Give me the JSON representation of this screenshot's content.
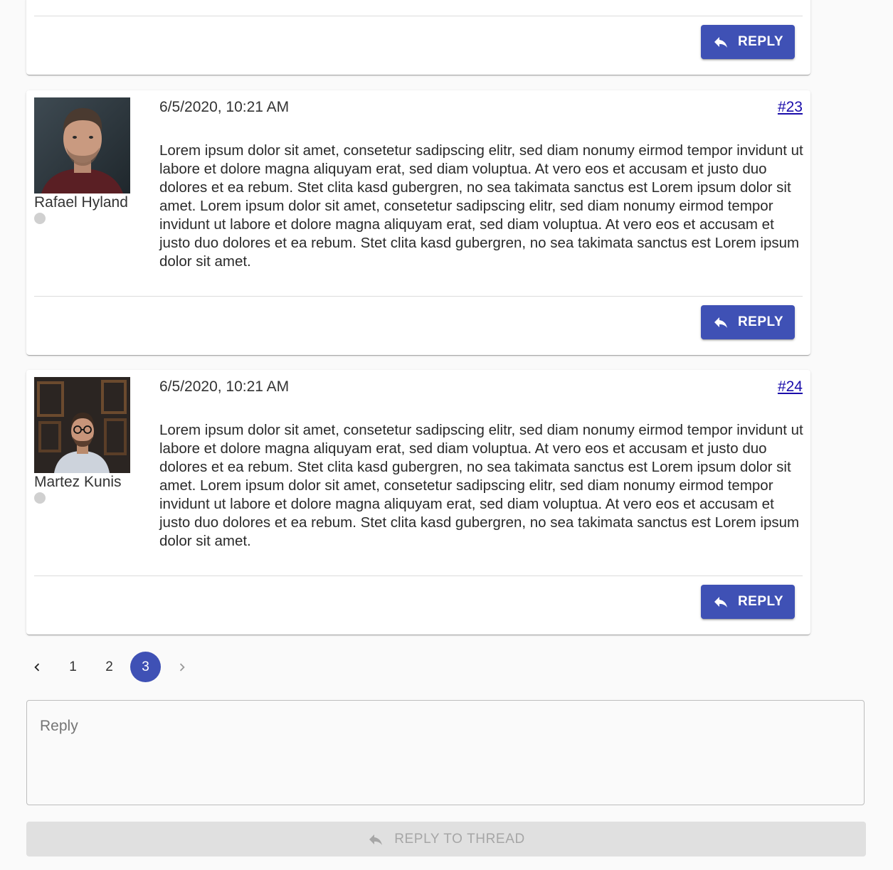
{
  "partial_post": {
    "reply_label": "REPLY"
  },
  "posts": [
    {
      "author": "Rafael Hyland",
      "date": "6/5/2020, 10:21 AM",
      "number": "#23",
      "body": "Lorem ipsum dolor sit amet, consetetur sadipscing elitr, sed diam nonumy eirmod tempor invidunt ut labore et dolore magna aliquyam erat, sed diam voluptua. At vero eos et accusam et justo duo dolores et ea rebum. Stet clita kasd gubergren, no sea takimata sanctus est Lorem ipsum dolor sit amet. Lorem ipsum dolor sit amet, consetetur sadipscing elitr, sed diam nonumy eirmod tempor invidunt ut labore et dolore magna aliquyam erat, sed diam voluptua. At vero eos et accusam et justo duo dolores et ea rebum. Stet clita kasd gubergren, no sea takimata sanctus est Lorem ipsum dolor sit amet.",
      "reply_label": "REPLY",
      "status": "offline"
    },
    {
      "author": "Martez Kunis",
      "date": "6/5/2020, 10:21 AM",
      "number": "#24",
      "body": "Lorem ipsum dolor sit amet, consetetur sadipscing elitr, sed diam nonumy eirmod tempor invidunt ut labore et dolore magna aliquyam erat, sed diam voluptua. At vero eos et accusam et justo duo dolores et ea rebum. Stet clita kasd gubergren, no sea takimata sanctus est Lorem ipsum dolor sit amet. Lorem ipsum dolor sit amet, consetetur sadipscing elitr, sed diam nonumy eirmod tempor invidunt ut labore et dolore magna aliquyam erat, sed diam voluptua. At vero eos et accusam et justo duo dolores et ea rebum. Stet clita kasd gubergren, no sea takimata sanctus est Lorem ipsum dolor sit amet.",
      "reply_label": "REPLY",
      "status": "offline"
    }
  ],
  "pagination": {
    "pages": [
      "1",
      "2",
      "3"
    ],
    "current": "3",
    "prev_icon": "chevron-left-icon",
    "next_icon": "chevron-right-icon"
  },
  "reply_box": {
    "placeholder": "Reply"
  },
  "reply_thread_button": {
    "label": "REPLY TO THREAD",
    "icon": "reply-icon",
    "disabled": true
  },
  "colors": {
    "accent": "#3f51b5",
    "link": "#1a0dab",
    "status_offline": "#d0d0d0",
    "disabled_bg": "#e0e0e0"
  }
}
